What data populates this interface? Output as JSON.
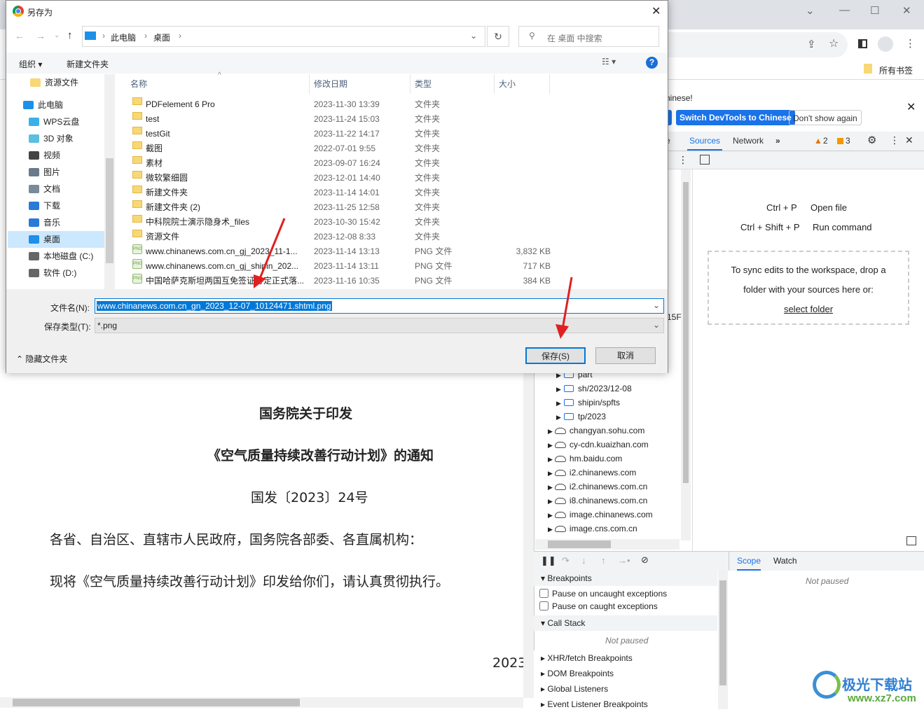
{
  "browser": {
    "bookmarks_label": "所有书签"
  },
  "devtools": {
    "infobar": {
      "text": "hinese!",
      "btn_partial": "e",
      "switch_btn": "Switch DevTools to Chinese",
      "dont_show": "Don't show again"
    },
    "tabs": [
      "e",
      "Sources",
      "Network"
    ],
    "warnings": "2",
    "messages": "3",
    "tree": [
      {
        "label": "part",
        "type": "folder"
      },
      {
        "label": "sh/2023/12-08",
        "type": "folder"
      },
      {
        "label": "shipin/spfts",
        "type": "folder"
      },
      {
        "label": "tp/2023",
        "type": "folder"
      },
      {
        "label": "changyan.sohu.com",
        "type": "cloud"
      },
      {
        "label": "cy-cdn.kuaizhan.com",
        "type": "cloud"
      },
      {
        "label": "hm.baidu.com",
        "type": "cloud"
      },
      {
        "label": "i2.chinanews.com",
        "type": "cloud"
      },
      {
        "label": "i2.chinanews.com.cn",
        "type": "cloud"
      },
      {
        "label": "i8.chinanews.com.cn",
        "type": "cloud"
      },
      {
        "label": "image.chinanews.com",
        "type": "cloud"
      },
      {
        "label": "image.cns.com.cn",
        "type": "cloud"
      }
    ],
    "partial_text": "15F",
    "editor": {
      "shortcut1_keys": "Ctrl + P",
      "shortcut1_label": "Open file",
      "shortcut2_keys": "Ctrl + Shift + P",
      "shortcut2_label": "Run command",
      "sync_line1": "To sync edits to the workspace, drop a",
      "sync_line2": "folder with your sources here or:",
      "select_folder": "select folder"
    },
    "sections": {
      "breakpoints": "Breakpoints",
      "pause_uncaught": "Pause on uncaught exceptions",
      "pause_caught": "Pause on caught exceptions",
      "call_stack": "Call Stack",
      "not_paused": "Not paused",
      "xhr": "XHR/fetch Breakpoints",
      "dom": "DOM Breakpoints",
      "global": "Global Listeners",
      "event": "Event Listener Breakpoints"
    },
    "scope_tab": "Scope",
    "watch_tab": "Watch",
    "scope_not_paused": "Not paused"
  },
  "page": {
    "title1": "国务院关于印发",
    "title2": "《空气质量持续改善行动计划》的通知",
    "doc_no": "国发〔2023〕24号",
    "para1": "各省、自治区、直辖市人民政府，国务院各部委、各直属机构：",
    "para2": "现将《空气质量持续改善行动计划》印发给你们，请认真贯彻执行。",
    "date_partial": "2023"
  },
  "dialog": {
    "title": "另存为",
    "breadcrumb": [
      "此电脑",
      "桌面"
    ],
    "search_placeholder": "在 桌面 中搜索",
    "organize": "组织",
    "new_folder": "新建文件夹",
    "nav": [
      {
        "label": "资源文件",
        "icon": "folder"
      },
      {
        "label": "此电脑",
        "icon": "pc"
      },
      {
        "label": "WPS云盘",
        "icon": "cloud"
      },
      {
        "label": "3D 对象",
        "icon": "3d"
      },
      {
        "label": "视频",
        "icon": "video"
      },
      {
        "label": "图片",
        "icon": "picture"
      },
      {
        "label": "文档",
        "icon": "document"
      },
      {
        "label": "下载",
        "icon": "download"
      },
      {
        "label": "音乐",
        "icon": "music"
      },
      {
        "label": "桌面",
        "icon": "desktop",
        "selected": true
      },
      {
        "label": "本地磁盘 (C:)",
        "icon": "drive"
      },
      {
        "label": "软件 (D:)",
        "icon": "drive"
      }
    ],
    "columns": [
      "名称",
      "修改日期",
      "类型",
      "大小"
    ],
    "files": [
      {
        "name": "PDFelement 6 Pro",
        "date": "2023-11-30 13:39",
        "type": "文件夹",
        "size": "",
        "icon": "folder"
      },
      {
        "name": "test",
        "date": "2023-11-24 15:03",
        "type": "文件夹",
        "size": "",
        "icon": "folder"
      },
      {
        "name": "testGit",
        "date": "2023-11-22 14:17",
        "type": "文件夹",
        "size": "",
        "icon": "folder"
      },
      {
        "name": "截图",
        "date": "2022-07-01 9:55",
        "type": "文件夹",
        "size": "",
        "icon": "folder"
      },
      {
        "name": "素材",
        "date": "2023-09-07 16:24",
        "type": "文件夹",
        "size": "",
        "icon": "folder"
      },
      {
        "name": "微软繁细圆",
        "date": "2023-12-01 14:40",
        "type": "文件夹",
        "size": "",
        "icon": "folder"
      },
      {
        "name": "新建文件夹",
        "date": "2023-11-14 14:01",
        "type": "文件夹",
        "size": "",
        "icon": "folder"
      },
      {
        "name": "新建文件夹 (2)",
        "date": "2023-11-25 12:58",
        "type": "文件夹",
        "size": "",
        "icon": "folder"
      },
      {
        "name": "中科院院士演示隐身术_files",
        "date": "2023-10-30 15:42",
        "type": "文件夹",
        "size": "",
        "icon": "folder"
      },
      {
        "name": "资源文件",
        "date": "2023-12-08 8:33",
        "type": "文件夹",
        "size": "",
        "icon": "folder"
      },
      {
        "name": "www.chinanews.com.cn_gj_2023_11-1...",
        "date": "2023-11-14 13:13",
        "type": "PNG 文件",
        "size": "3,832 KB",
        "icon": "png"
      },
      {
        "name": "www.chinanews.com.cn_gj_shipin_202...",
        "date": "2023-11-14 13:11",
        "type": "PNG 文件",
        "size": "717 KB",
        "icon": "png"
      },
      {
        "name": "中国哈萨克斯坦两国互免签证协定正式落...",
        "date": "2023-11-16 10:35",
        "type": "PNG 文件",
        "size": "384 KB",
        "icon": "png"
      }
    ],
    "filename_label": "文件名(N):",
    "filename_value": "www.chinanews.com.cn_gn_2023_12-07_10124471.shtml.png",
    "filetype_label": "保存类型(T):",
    "filetype_value": "*.png",
    "hide_folders": "隐藏文件夹",
    "save": "保存(S)",
    "cancel": "取消"
  },
  "watermark": {
    "text": "极光下载站",
    "url": "www.xz7.com"
  },
  "colors": {
    "accent": "#1a73e8",
    "dialog_accent": "#0078d7",
    "arrow": "#e02020"
  }
}
